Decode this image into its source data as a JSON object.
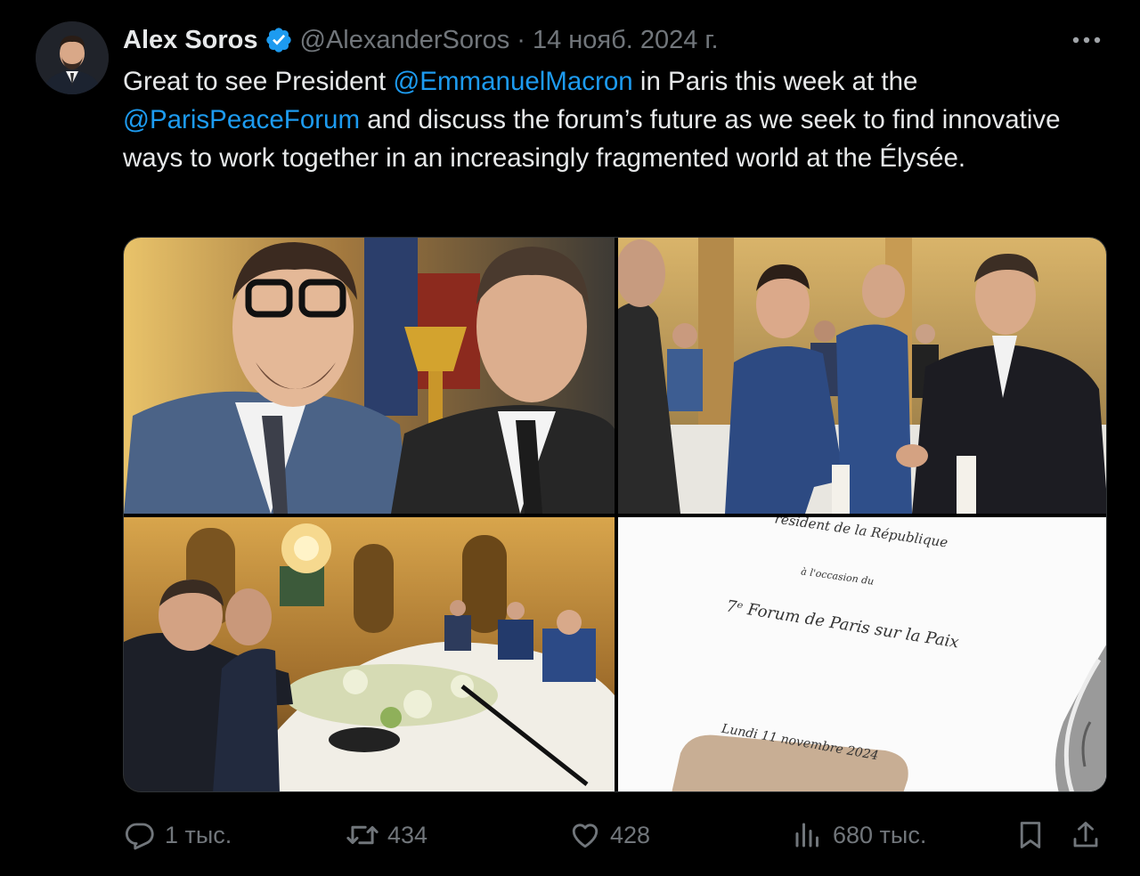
{
  "author": {
    "name": "Alex Soros",
    "handle": "@AlexanderSoros",
    "separator": "·",
    "date": "14 нояб. 2024 г.",
    "verified": true
  },
  "tweet": {
    "text_1": "Great to see President ",
    "mention_1": "@EmmanuelMacron",
    "text_2": " in Paris this week at the ",
    "mention_2": "@ParisPeaceForum",
    "text_3": " and discuss the forum’s future as we seek to find innovative ways to work together in an increasingly fragmented world at the Élysée."
  },
  "media": {
    "invitation": {
      "line_1": "résident de la République",
      "line_2": "à l'occasion du",
      "line_3": "7ᵉ Forum de Paris sur la Paix",
      "line_4": "Lundi 11 novembre 2024"
    }
  },
  "actions": {
    "replies": "1 тыс.",
    "retweets": "434",
    "likes": "428",
    "views": "680 тыс."
  },
  "icons": {
    "verified": "verified-badge-icon",
    "more": "more-icon",
    "reply": "reply-icon",
    "retweet": "retweet-icon",
    "like": "heart-icon",
    "views": "views-icon",
    "bookmark": "bookmark-icon",
    "share": "share-icon"
  },
  "colors": {
    "background": "#000000",
    "text": "#e7e9ea",
    "muted": "#71767b",
    "accent": "#1d9bf0"
  }
}
